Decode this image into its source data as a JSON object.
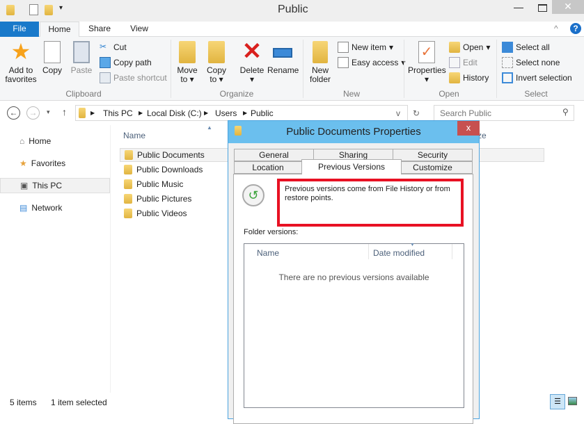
{
  "window": {
    "title": "Public"
  },
  "ribbon_tabs": [
    "File",
    "Home",
    "Share",
    "View"
  ],
  "clipboard": {
    "add_to_favorites": "Add to favorites",
    "copy": "Copy",
    "paste": "Paste",
    "cut": "Cut",
    "copy_path": "Copy path",
    "paste_shortcut": "Paste shortcut",
    "group": "Clipboard"
  },
  "organize": {
    "move_to": "Move to",
    "copy_to": "Copy to",
    "delete": "Delete",
    "rename": "Rename",
    "group": "Organize"
  },
  "new": {
    "new_folder": "New folder",
    "new_item": "New item",
    "easy_access": "Easy access",
    "group": "New"
  },
  "open": {
    "properties": "Properties",
    "open": "Open",
    "edit": "Edit",
    "history": "History",
    "group": "Open"
  },
  "select": {
    "select_all": "Select all",
    "select_none": "Select none",
    "invert": "Invert selection",
    "group": "Select"
  },
  "address": {
    "crumbs": [
      "This PC",
      "Local Disk (C:)",
      "Users",
      "Public"
    ],
    "search_placeholder": "Search Public"
  },
  "nav": {
    "items": [
      "Home",
      "Favorites",
      "This PC",
      "Network"
    ]
  },
  "files": {
    "header_name": "Name",
    "header_size": "ze",
    "items": [
      "Public Documents",
      "Public Downloads",
      "Public Music",
      "Public Pictures",
      "Public Videos"
    ]
  },
  "status": {
    "count": "5 items",
    "selected": "1 item selected"
  },
  "dialog": {
    "title": "Public Documents Properties",
    "close": "x",
    "tabs_row1": [
      "General",
      "Sharing",
      "Security"
    ],
    "tabs_row2": [
      "Location",
      "Previous Versions",
      "Customize"
    ],
    "info": "Previous versions come from File History or from restore points.",
    "folder_versions": "Folder versions:",
    "col_name": "Name",
    "col_date": "Date modified",
    "empty": "There are no previous versions available"
  },
  "colors": {
    "accent": "#1979ca",
    "dialog_title": "#6bbfee",
    "highlight": "#e81123"
  }
}
